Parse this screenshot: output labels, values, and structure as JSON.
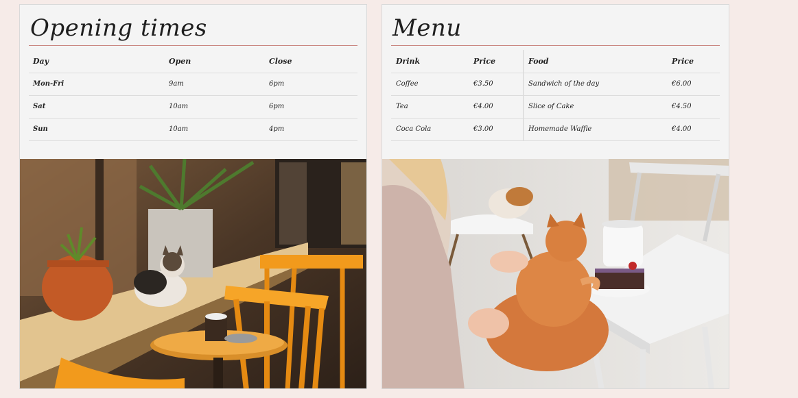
{
  "opening_times": {
    "title": "Opening times",
    "headers": {
      "day": "Day",
      "open": "Open",
      "close": "Close"
    },
    "rows": [
      {
        "day": "Mon-Fri",
        "open": "9am",
        "close": "6pm"
      },
      {
        "day": "Sat",
        "open": "10am",
        "close": "6pm"
      },
      {
        "day": "Sun",
        "open": "10am",
        "close": "4pm"
      }
    ]
  },
  "menu": {
    "title": "Menu",
    "headers": {
      "drink": "Drink",
      "drink_price": "Price",
      "food": "Food",
      "food_price": "Price"
    },
    "rows": [
      {
        "drink": "Coffee",
        "drink_price": "€3.50",
        "food": "Sandwich of the day",
        "food_price": "€6.00"
      },
      {
        "drink": "Tea",
        "drink_price": "€4.00",
        "food": "Slice of Cake",
        "food_price": "€4.50"
      },
      {
        "drink": "Coca Cola",
        "drink_price": "€3.00",
        "food": "Homemade Waffle",
        "food_price": "€4.00"
      }
    ]
  },
  "colors": {
    "page_background": "#f6ebe8",
    "card_background": "#f4f4f4",
    "accent_rule": "#c9857f"
  }
}
